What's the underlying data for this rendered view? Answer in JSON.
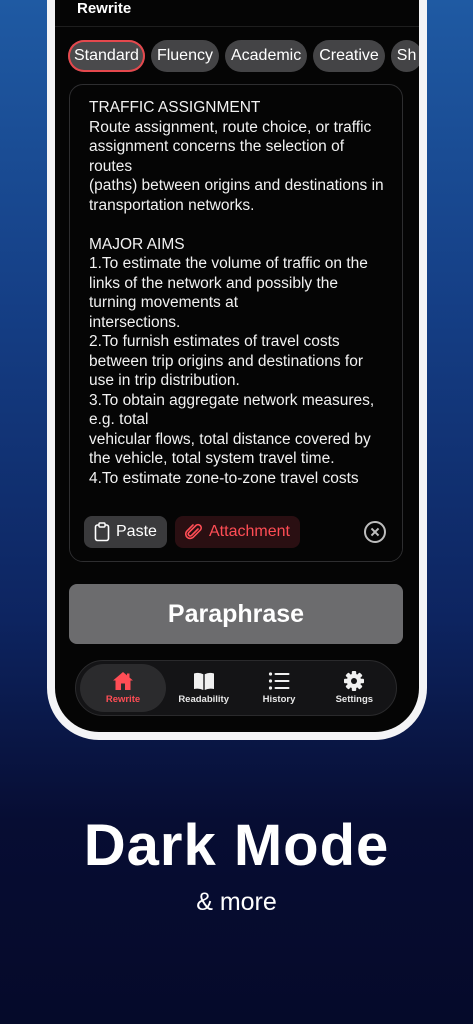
{
  "header": {
    "title": "Rewrite"
  },
  "modes": [
    {
      "label": "Standard",
      "active": true
    },
    {
      "label": "Fluency",
      "active": false
    },
    {
      "label": "Academic",
      "active": false
    },
    {
      "label": "Creative",
      "active": false
    },
    {
      "label": "Sh",
      "active": false
    }
  ],
  "editor": {
    "text": "TRAFFIC ASSIGNMENT\nRoute assignment, route choice, or traffic\nassignment concerns the selection of routes\n(paths) between origins and destinations in\ntransportation networks.\n\nMAJOR AIMS\n1.To estimate the volume of traffic on the links of the network and possibly the turning movements at\nintersections.\n2.To furnish estimates of travel costs between trip origins and destinations for use in trip distribution.\n3.To obtain aggregate network measures, e.g. total\nvehicular flows, total distance covered by the vehicle, total system travel time.\n4.To estimate zone-to-zone travel costs",
    "paste_label": "Paste",
    "attachment_label": "Attachment"
  },
  "paraphrase_label": "Paraphrase",
  "tabs": [
    {
      "label": "Rewrite",
      "icon": "house-icon",
      "active": true
    },
    {
      "label": "Readability",
      "icon": "book-icon",
      "active": false
    },
    {
      "label": "History",
      "icon": "list-icon",
      "active": false
    },
    {
      "label": "Settings",
      "icon": "gear-icon",
      "active": false
    }
  ],
  "promo": {
    "title": "Dark Mode",
    "subtitle": "& more"
  },
  "colors": {
    "accent": "#ff4d55",
    "chip": "#444446",
    "button": "#6c6c6e"
  }
}
